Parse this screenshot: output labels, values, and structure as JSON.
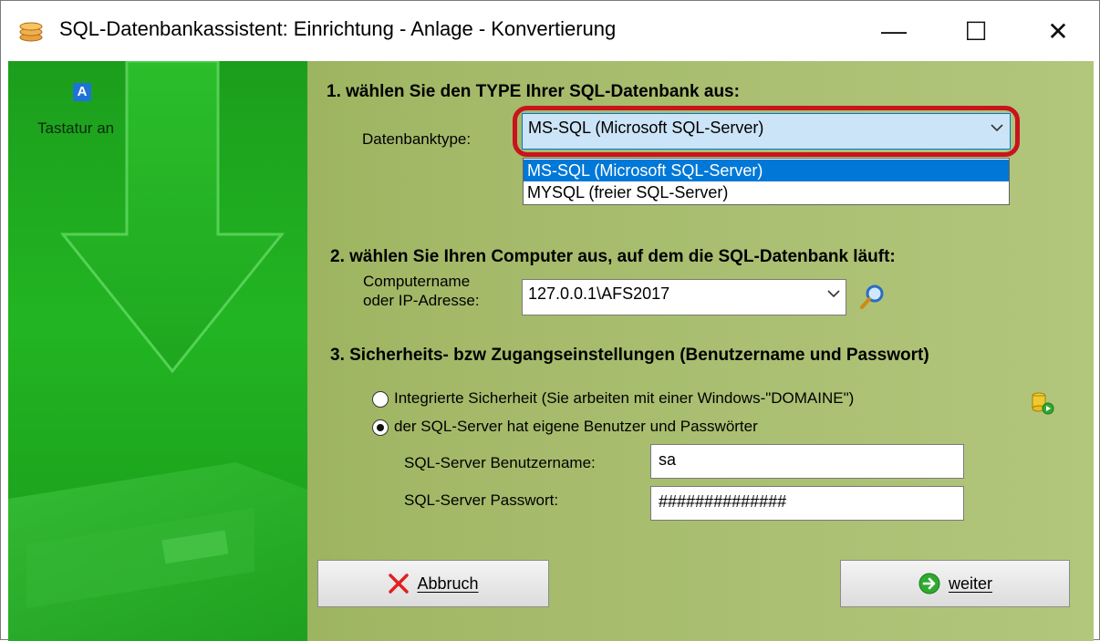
{
  "window": {
    "title": "SQL-Datenbankassistent:  Einrichtung - Anlage - Konvertierung",
    "minimize": "—",
    "maximize": "☐",
    "close": "✕"
  },
  "sidebar": {
    "keyboard_icon_letter": "A",
    "keyboard_label": "Tastatur an"
  },
  "step1": {
    "heading": "1. wählen Sie den TYPE Ihrer SQL-Datenbank aus:",
    "label": "Datenbanktype:",
    "selected": "MS-SQL (Microsoft SQL-Server)",
    "options": [
      "MS-SQL (Microsoft SQL-Server)",
      "MYSQL (freier SQL-Server)"
    ]
  },
  "step2": {
    "heading": "2. wählen Sie Ihren Computer aus, auf dem die SQL-Datenbank läuft:",
    "label_line1": "Computername",
    "label_line2": "oder IP-Adresse:",
    "value": "127.0.0.1\\AFS2017"
  },
  "step3": {
    "heading": "3. Sicherheits- bzw Zugangseinstellungen (Benutzername und Passwort)",
    "radio_integrated": "Integrierte Sicherheit (Sie arbeiten mit einer Windows-\"DOMAINE\")",
    "radio_sqlserver": "der SQL-Server hat eigene Benutzer und Passwörter",
    "selected_radio": "sqlserver",
    "username_label": "SQL-Server Benutzername:",
    "username_value": "sa",
    "password_label": "SQL-Server Passwort:",
    "password_value": "##############"
  },
  "buttons": {
    "cancel_label": "Abbruch",
    "next_label": "weiter"
  },
  "colors": {
    "selection": "#0078d7",
    "highlight_outline": "#c8141c",
    "sidebar_green": "#22b522",
    "panel_olive": "#a3b968"
  }
}
